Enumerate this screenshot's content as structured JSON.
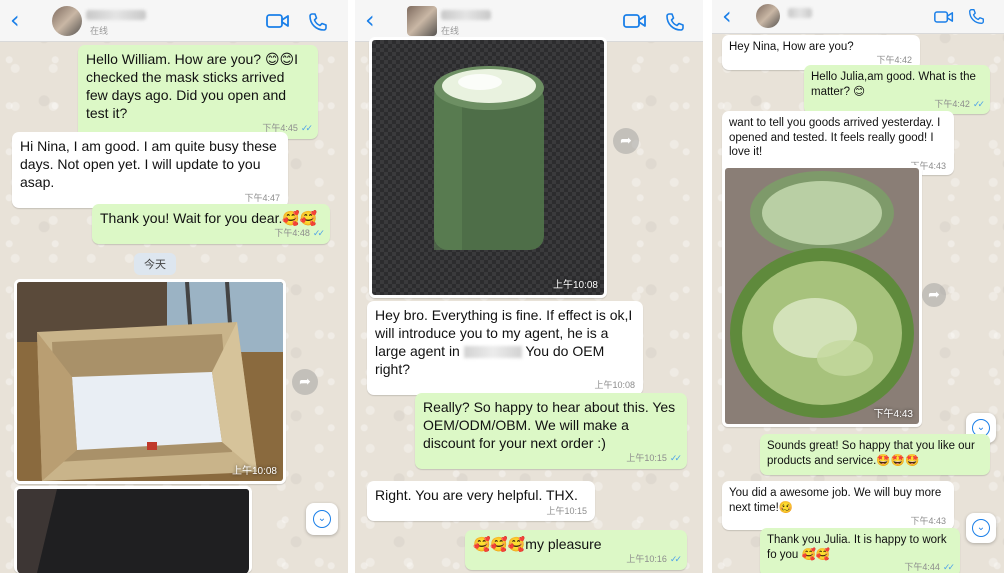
{
  "panel1": {
    "status": "在线",
    "messages": [
      {
        "text": "Hello William. How are you? 😊😊I checked the mask sticks arrived few days ago. Did you open and test it?",
        "time": "下午4:45"
      },
      {
        "text": "Hi Nina, I am good. I am quite busy these days. Not open yet. I will update to you asap.",
        "time": "下午4:47"
      },
      {
        "text": "Thank you! Wait for you dear.🥰🥰",
        "time": "下午4:48"
      }
    ],
    "day_divider": "今天",
    "photo_time": "上午10:08"
  },
  "panel2": {
    "status": "在线",
    "photo_time": "上午10:08",
    "messages": [
      {
        "text_a": "Hey bro. Everything is fine. If effect is ok,I will introduce you to my agent, he is a large agent in",
        "text_b": " You do OEM right?",
        "time": "上午10:08"
      },
      {
        "text": "Really? So happy to hear about this. Yes OEM/ODM/OBM. We will make a discount for your next order :)",
        "time": "上午10:15"
      },
      {
        "text": "Right. You are very helpful. THX.",
        "time": "上午10:15"
      },
      {
        "text": "🥰🥰🥰my pleasure",
        "time": "上午10:16"
      }
    ]
  },
  "panel3": {
    "messages": [
      {
        "text": "Hey Nina, How are you?",
        "time": "下午4:42"
      },
      {
        "text": "Hello Julia,am good. What is the matter? 😊",
        "time": "下午4:42"
      },
      {
        "text": "want to tell you goods arrived yesterday. I opened and tested. It feels really good! I love it!",
        "time": "下午4:43"
      },
      {
        "text": "Sounds great! So happy that you like our products and service.🤩🤩🤩",
        "time": ""
      },
      {
        "text": "You did a awesome job. We will buy more next time!🥴",
        "time": "下午4:43"
      },
      {
        "text": "Thank you Julia. It is happy to work fo you 🥰🥰",
        "time": "下午4:44"
      }
    ],
    "photo_time": "下午4:43"
  },
  "icons": {
    "back": "chevron-left",
    "video": "video-camera",
    "call": "phone",
    "forward": "forward-arrow",
    "scroll_down": "chevron-down-circle",
    "read_ticks": "double-check"
  },
  "colors": {
    "outgoing_bubble": "#dcf8c6",
    "incoming_bubble": "#ffffff",
    "accent": "#1a7fe8",
    "chat_background": "#e8e2d8"
  }
}
